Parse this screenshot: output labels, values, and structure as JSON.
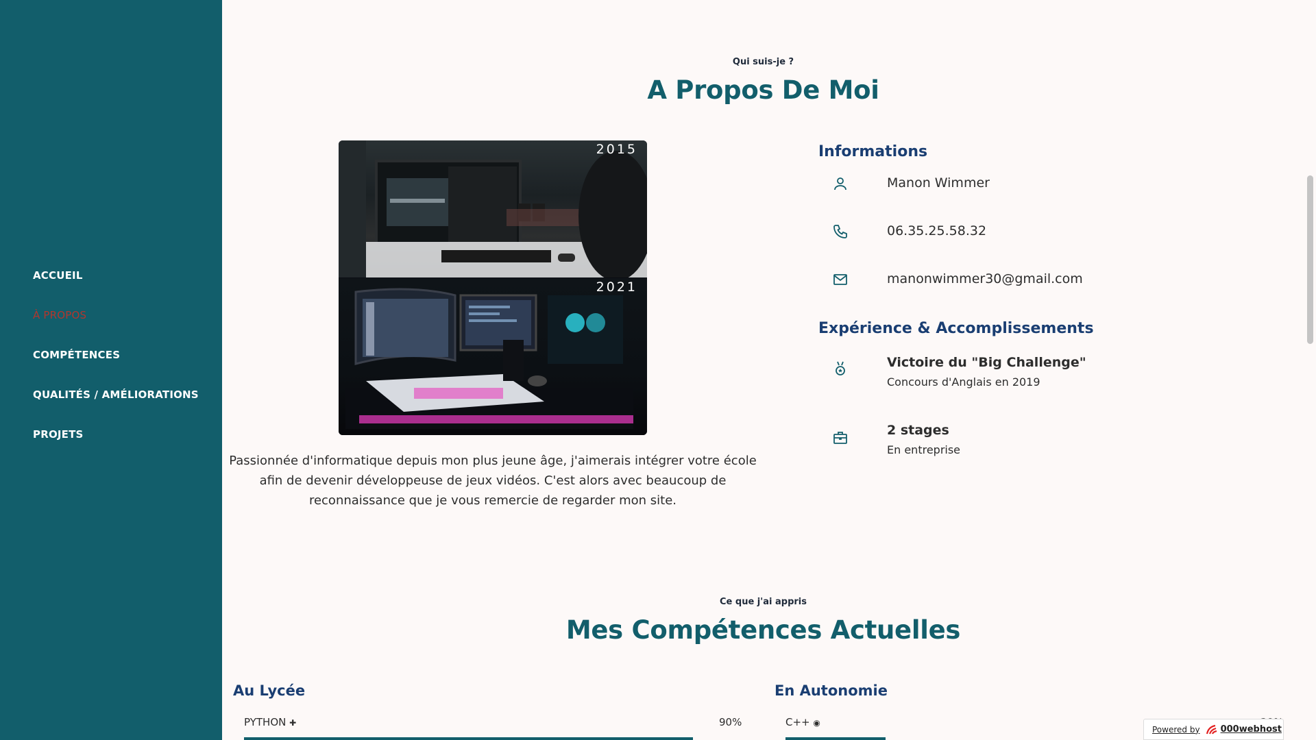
{
  "nav": {
    "items": [
      {
        "label": "ACCUEIL",
        "active": false
      },
      {
        "label": "À PROPOS",
        "active": true
      },
      {
        "label": "COMPÉTENCES",
        "active": false
      },
      {
        "label": "QUALITÉS / AMÉLIORATIONS",
        "active": false
      },
      {
        "label": "PROJETS",
        "active": false
      }
    ],
    "active_color": "#b2362d"
  },
  "about": {
    "eyebrow": "Qui suis-je ?",
    "title": "A Propos De Moi",
    "photo_years": [
      "2015",
      "2021"
    ],
    "bio": "Passionnée d'informatique depuis mon plus jeune âge, j'aimerais intégrer votre école afin de devenir développeuse de jeux vidéos. C'est alors avec beaucoup de reconnaissance que je vous remercie de regarder mon site.",
    "info_title": "Informations",
    "name": "Manon Wimmer",
    "phone": "06.35.25.58.32",
    "email": "manonwimmer30@gmail.com",
    "experience_title": "Expérience & Accomplissements",
    "achievements": [
      {
        "icon": "medal-icon",
        "title": "Victoire du \"Big Challenge\"",
        "subtitle": "Concours d'Anglais en 2019"
      },
      {
        "icon": "briefcase-icon",
        "title": "2 stages",
        "subtitle": "En entreprise"
      }
    ]
  },
  "skills": {
    "eyebrow": "Ce que j'ai appris",
    "title": "Mes Compétences Actuelles",
    "left": {
      "heading": "Au Lycée",
      "items": [
        {
          "name": "PYTHON",
          "icon": "python-icon",
          "level": 0.9,
          "percent": "90%"
        }
      ]
    },
    "right": {
      "heading": "En Autonomie",
      "items": [
        {
          "name": "C++",
          "icon": "cpp-icon",
          "level": 0.2,
          "percent": "20%"
        }
      ]
    }
  },
  "badge": {
    "prefix": "Powered by",
    "brand": "000webhost"
  },
  "colors": {
    "sidebar": "#125e6b",
    "accent": "#125e6b",
    "heading_blue": "#1a3e72",
    "background": "#fdf9f8"
  }
}
